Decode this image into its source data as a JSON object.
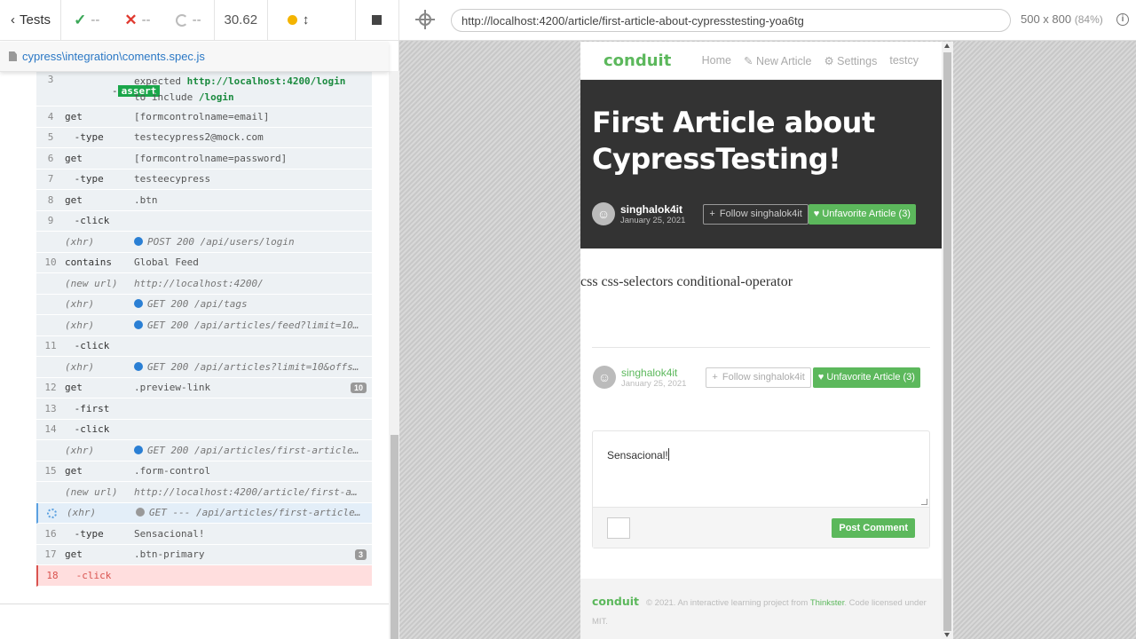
{
  "topbar": {
    "tests_label": "Tests",
    "passed": "--",
    "failed": "--",
    "pending": "--",
    "duration": "30.62"
  },
  "spec": {
    "path": "cypress\\integration\\coments.spec.js"
  },
  "command_log": {
    "assert": {
      "num": "3",
      "name": "-assert",
      "msg_pre": "expected ",
      "msg_url": "http://localhost:4200/login",
      "msg_mid": "to include ",
      "msg_path": "/login"
    },
    "rows": [
      {
        "num": "4",
        "name": "get",
        "msg": "[formcontrolname=email]"
      },
      {
        "num": "5",
        "name": " -type",
        "msg": "testecypress2@mock.com"
      },
      {
        "num": "6",
        "name": "get",
        "msg": "[formcontrolname=password]"
      },
      {
        "num": "7",
        "name": " -type",
        "msg": "testeecypress"
      },
      {
        "num": "8",
        "name": "get",
        "msg": ".btn"
      },
      {
        "num": "9",
        "name": " -click",
        "msg": ""
      },
      {
        "num": "",
        "name": "(xhr)",
        "msg": "POST 200 /api/users/login"
      },
      {
        "num": "10",
        "name": "contains",
        "msg": "Global Feed"
      },
      {
        "num": "",
        "name": "(new url)",
        "msg": "http://localhost:4200/"
      },
      {
        "num": "",
        "name": "(xhr)",
        "msg": "GET 200 /api/tags"
      },
      {
        "num": "",
        "name": "(xhr)",
        "msg": "GET 200 /api/articles/feed?limit=10&…"
      },
      {
        "num": "11",
        "name": " -click",
        "msg": ""
      },
      {
        "num": "",
        "name": "(xhr)",
        "msg": "GET 200 /api/articles?limit=10&offse…"
      },
      {
        "num": "12",
        "name": "get",
        "msg": ".preview-link",
        "badge": "10"
      },
      {
        "num": "13",
        "name": " -first",
        "msg": ""
      },
      {
        "num": "14",
        "name": " -click",
        "msg": ""
      },
      {
        "num": "",
        "name": "(xhr)",
        "msg": "GET 200 /api/articles/first-article-…"
      },
      {
        "num": "15",
        "name": "get",
        "msg": ".form-control"
      },
      {
        "num": "",
        "name": "(new url)",
        "msg": "http://localhost:4200/article/first-ar…"
      },
      {
        "num": "",
        "name": "(xhr)",
        "msg": "GET --- /api/articles/first-article-…"
      },
      {
        "num": "16",
        "name": " -type",
        "msg": "Sensacional!"
      },
      {
        "num": "17",
        "name": "get",
        "msg": ".btn-primary",
        "badge": "3"
      },
      {
        "num": "18",
        "name": " -click",
        "msg": ""
      }
    ]
  },
  "aut": {
    "url": "http://localhost:4200/article/first-article-about-cypresstesting-yoa6tg",
    "viewport": "500 x 800",
    "scale": "(84%)"
  },
  "app": {
    "brand": "conduit",
    "nav": {
      "home": "Home",
      "new_article": "New Article",
      "settings": "Settings",
      "user": "testcy"
    },
    "article_title": "First Article about CypressTesting!",
    "author": "singhalok4it",
    "date": "January 25, 2021",
    "follow_label": "Follow singhalok4it",
    "unfavorite_label": "Unfavorite Article (3)",
    "tags": "css css-selectors conditional-operator",
    "comment_text": "Sensacional!",
    "post_label": "Post Comment",
    "footer_logo": "conduit",
    "footer_text_1": "© 2021. An interactive learning project from ",
    "footer_link": "Thinkster",
    "footer_text_2": ". Code licensed under MIT."
  },
  "colors": {
    "brand": "#5cb85c",
    "pass": "#3aa757",
    "fail": "#e0392f",
    "xhr": "#2a7fd4"
  }
}
